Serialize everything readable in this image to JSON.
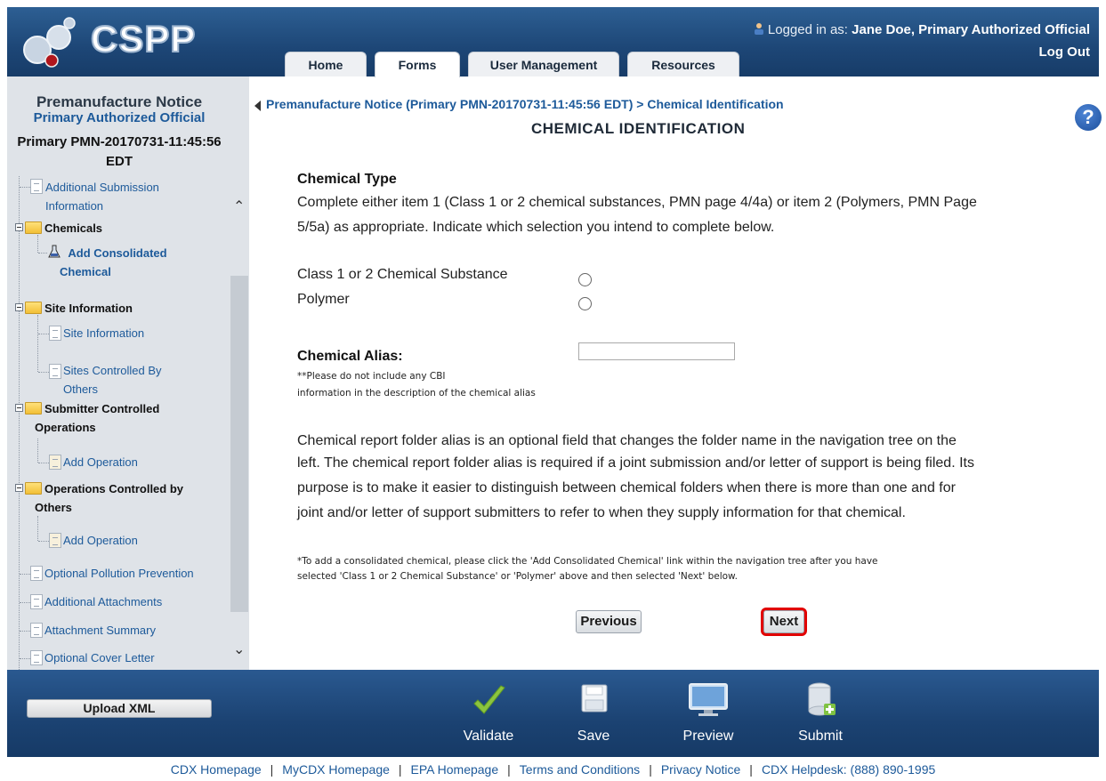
{
  "header": {
    "logo_text": "CSPP",
    "login_prefix": "Logged in as:",
    "login_user": "Jane Doe, Primary Authorized Official",
    "logout": "Log Out"
  },
  "tabs": [
    {
      "label": "Home"
    },
    {
      "label": "Forms"
    },
    {
      "label": "User Management"
    },
    {
      "label": "Resources"
    }
  ],
  "sidebar": {
    "title": "Premanufacture Notice",
    "role": "Primary Authorized Official",
    "pmn_id_line1": "Primary PMN-20170731-11:45:56",
    "pmn_id_line2": "EDT",
    "items": [
      {
        "label": "Additional Submission",
        "label2": "Information"
      },
      {
        "label": "Chemicals"
      },
      {
        "label": "Add Consolidated",
        "label2": "Chemical"
      },
      {
        "label": "Site Information"
      },
      {
        "label": "Site Information"
      },
      {
        "label": "Sites Controlled By",
        "label2": "Others"
      },
      {
        "label": "Submitter Controlled",
        "label2": "Operations"
      },
      {
        "label": "Add Operation"
      },
      {
        "label": "Operations Controlled by",
        "label2": "Others"
      },
      {
        "label": "Add Operation"
      },
      {
        "label": "Optional Pollution Prevention"
      },
      {
        "label": "Additional Attachments"
      },
      {
        "label": "Attachment Summary"
      },
      {
        "label": "Optional Cover Letter"
      }
    ]
  },
  "main": {
    "breadcrumb": "Premanufacture Notice (Primary PMN-20170731-11:45:56 EDT) > Chemical Identification",
    "title": "CHEMICAL IDENTIFICATION",
    "chem_type_heading": "Chemical Type",
    "chem_type_para_1": "Complete either item 1 (Class 1 or 2 chemical substances, PMN page 4/4a) or item 2 (Polymers, PMN Page",
    "chem_type_para_2": "5/5a) as appropriate. Indicate which selection you intend to complete below.",
    "radio_class": "Class 1 or 2 Chemical Substance",
    "radio_polymer": "Polymer",
    "alias_label": "Chemical Alias:",
    "alias_value": "",
    "alias_note_1": "**Please do not include any CBI",
    "alias_note_2": "information in the description of the chemical alias",
    "alias_para": [
      "Chemical report folder alias is an optional field that changes the folder name in the navigation tree on the",
      "left. The chemical report folder alias is required if a joint submission and/or letter of support is being filed. Its",
      "purpose is to make it easier to distinguish between chemical folders when there is more than one and for",
      "joint and/or letter of support submitters to refer to when they supply information for that chemical."
    ],
    "consolidated_note_1": "*To add a consolidated chemical, please click the 'Add Consolidated Chemical' link within the navigation tree after you have",
    "consolidated_note_2": "selected 'Class 1 or 2 Chemical Substance' or 'Polymer' above and then selected 'Next' below.",
    "previous": "Previous",
    "next": "Next"
  },
  "footer_bar": {
    "upload": "Upload XML",
    "validate": "Validate",
    "save": "Save",
    "preview": "Preview",
    "submit": "Submit"
  },
  "footer_links": [
    "CDX Homepage",
    "MyCDX Homepage",
    "EPA Homepage",
    "Terms and Conditions",
    "Privacy Notice",
    "CDX Helpdesk: (888) 890-1995"
  ]
}
